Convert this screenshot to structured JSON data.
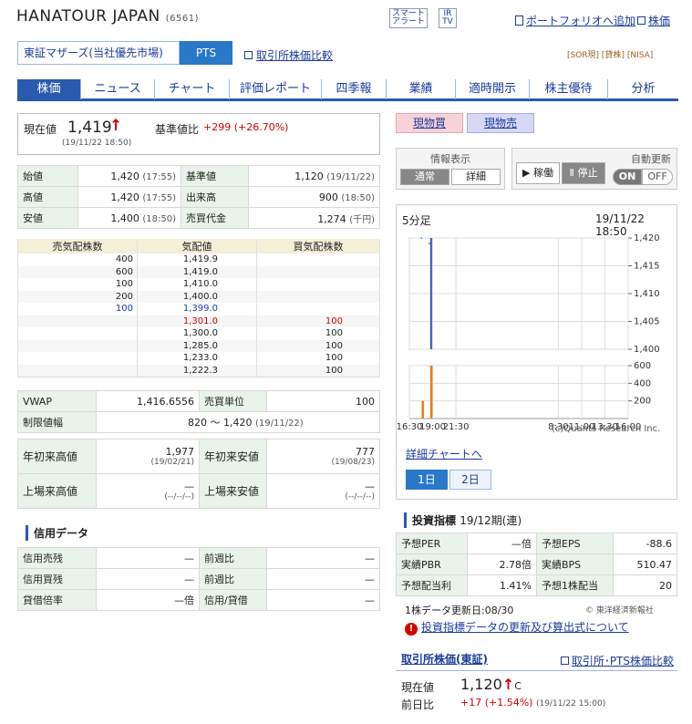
{
  "header": {
    "company": "HANATOUR JAPAN",
    "code": "(6561)",
    "smart_alert": "スマート\nアラート",
    "ir_tv": "IR\nTV",
    "portfolio_link": "ポートフォリオへ追加",
    "price_link": "株価"
  },
  "market": {
    "tab1": "東証マザーズ(当社優先市場)",
    "tab2": "PTS",
    "compare_link": "取引所株価比較",
    "tags": "[SOR現] [貸株] [NISA]"
  },
  "nav": [
    "株価",
    "ニュース",
    "チャート",
    "評価レポート",
    "四季報",
    "業績",
    "適時開示",
    "株主優待",
    "分析"
  ],
  "price": {
    "label": "現在値",
    "value": "1,419",
    "arrow": "↑",
    "time": "(19/11/22 18:50)",
    "base_label": "基準値比",
    "change": "+299 (+26.70%)"
  },
  "summary": [
    {
      "l1": "始値",
      "v1": "1,420",
      "t1": "(17:55)",
      "l2": "基準値",
      "v2": "1,120",
      "t2": "(19/11/22)"
    },
    {
      "l1": "高値",
      "v1": "1,420",
      "t1": "(17:55)",
      "l2": "出来高",
      "v2": "900",
      "t2": "(18:50)"
    },
    {
      "l1": "安値",
      "v1": "1,400",
      "t1": "(18:50)",
      "l2": "売買代金",
      "v2": "1,274",
      "t2": "(千円)"
    }
  ],
  "orderbook": {
    "headers": [
      "売気配株数",
      "気配値",
      "買気配株数"
    ],
    "rows": [
      [
        "400",
        "1,419.9",
        ""
      ],
      [
        "600",
        "1,419.0",
        ""
      ],
      [
        "100",
        "1,410.0",
        ""
      ],
      [
        "200",
        "1,400.0",
        ""
      ],
      [
        "100",
        "1,399.0",
        ""
      ],
      [
        "",
        "1,301.0",
        "100"
      ],
      [
        "",
        "1,300.0",
        "100"
      ],
      [
        "",
        "1,285.0",
        "100"
      ],
      [
        "",
        "1,233.0",
        "100"
      ],
      [
        "",
        "1,222.3",
        "100"
      ]
    ]
  },
  "vwap": {
    "l1": "VWAP",
    "v1": "1,416.6556",
    "l2": "売買単位",
    "v2": "100",
    "limit_label": "制限値幅",
    "limit_value": "820 〜 1,420",
    "limit_date": "(19/11/22)"
  },
  "yearly": {
    "ytd_high_label": "年初来高値",
    "ytd_high": "1,977",
    "ytd_high_date": "(19/02/21)",
    "ytd_low_label": "年初来安値",
    "ytd_low": "777",
    "ytd_low_date": "(19/08/23)",
    "list_high_label": "上場来高値",
    "list_high": "—",
    "list_high_date": "(--/--/--)",
    "list_low_label": "上場来安値",
    "list_low": "—",
    "list_low_date": "(--/--/--)"
  },
  "credit": {
    "title": "信用データ",
    "rows": [
      [
        "信用売残",
        "—",
        "前週比",
        "—"
      ],
      [
        "信用買残",
        "—",
        "前週比",
        "—"
      ],
      [
        "貸借倍率",
        "—倍",
        "信用/貸借",
        "—"
      ]
    ]
  },
  "trade": {
    "buy": "現物買",
    "sell": "現物売"
  },
  "display": {
    "title": "情報表示",
    "normal": "通常",
    "detail": "詳細",
    "auto_title": "自動更新",
    "running": "▶ 稼働",
    "stop": "Ⅱ 停止",
    "on": "ON",
    "off": "OFF"
  },
  "chart": {
    "period": "5分足",
    "datetime": "19/11/22 18:50",
    "copyright": "(c)Quants Research Inc.",
    "detail_link": "詳細チャートへ",
    "btn1": "1日",
    "btn2": "2日"
  },
  "chart_data": {
    "type": "line",
    "price_ticks": [
      "1,420",
      "1,415",
      "1,410",
      "1,405",
      "1,400"
    ],
    "vol_ticks": [
      "600",
      "400",
      "200"
    ],
    "x_ticks": [
      "16:30",
      "19:00",
      "21:30",
      "8:30",
      "11:00",
      "13:30",
      "16:00"
    ],
    "price": {
      "ylim": [
        1400,
        1420
      ],
      "points": [
        {
          "x": "18:00",
          "y": 1420
        },
        {
          "x": "18:50",
          "y": 1419
        }
      ],
      "bar": {
        "x": "18:50",
        "low": 1400,
        "high": 1420
      }
    },
    "volume": {
      "ylim": [
        0,
        600
      ],
      "bars": [
        {
          "x": "17:55",
          "v": 200
        },
        {
          "x": "18:50",
          "v": 700
        }
      ]
    }
  },
  "indicators": {
    "title": "投資指標",
    "period": "19/12期(連)",
    "rows": [
      [
        "予想PER",
        "—倍",
        "予想EPS",
        "-88.6"
      ],
      [
        "実績PBR",
        "2.78倍",
        "実績BPS",
        "510.47"
      ],
      [
        "予想配当利",
        "1.41%",
        "予想1株配当",
        "20"
      ]
    ],
    "update": "1株データ更新日:08/30",
    "source": "東洋経済新報社",
    "notice": "投資指標データの更新及び算出式について"
  },
  "exchange": {
    "title": "取引所株価(東証)",
    "link": "取引所･PTS株価比較",
    "price_label": "現在値",
    "price": "1,120",
    "arrow": "↑",
    "suffix": "C",
    "prev_label": "前日比",
    "change": "+17 (+1.54%)",
    "time": "(19/11/22 15:00)"
  },
  "colors": {
    "accent": "#2a5ab0",
    "up": "#d40000",
    "label_bg": "#eaf3ea"
  }
}
